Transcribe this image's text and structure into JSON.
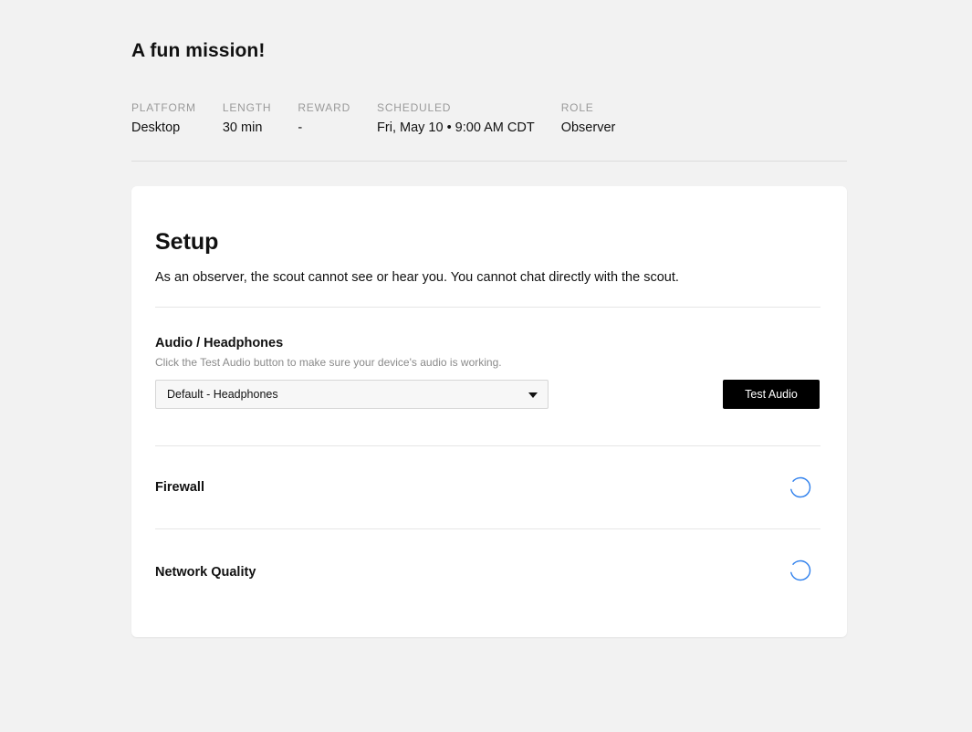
{
  "mission": {
    "title": "A fun mission!"
  },
  "meta": [
    {
      "label": "PLATFORM",
      "value": "Desktop"
    },
    {
      "label": "LENGTH",
      "value": "30 min"
    },
    {
      "label": "REWARD",
      "value": "-"
    },
    {
      "label": "SCHEDULED",
      "value": "Fri, May 10 • 9:00 AM CDT"
    },
    {
      "label": "ROLE",
      "value": "Observer"
    }
  ],
  "setup": {
    "title": "Setup",
    "description": "As an observer, the scout cannot see or hear you. You cannot chat directly with the scout.",
    "audio": {
      "title": "Audio / Headphones",
      "hint": "Click the Test Audio button to make sure your device's audio is working.",
      "selected_device": "Default - Headphones",
      "test_button_label": "Test Audio"
    },
    "checks": [
      {
        "label": "Firewall",
        "status_icon": "loading-spinner-icon"
      },
      {
        "label": "Network Quality",
        "status_icon": "loading-spinner-icon"
      }
    ]
  },
  "colors": {
    "background": "#f2f2f2",
    "card": "#ffffff",
    "button": "#000000",
    "spinner": "#2f80ed"
  }
}
